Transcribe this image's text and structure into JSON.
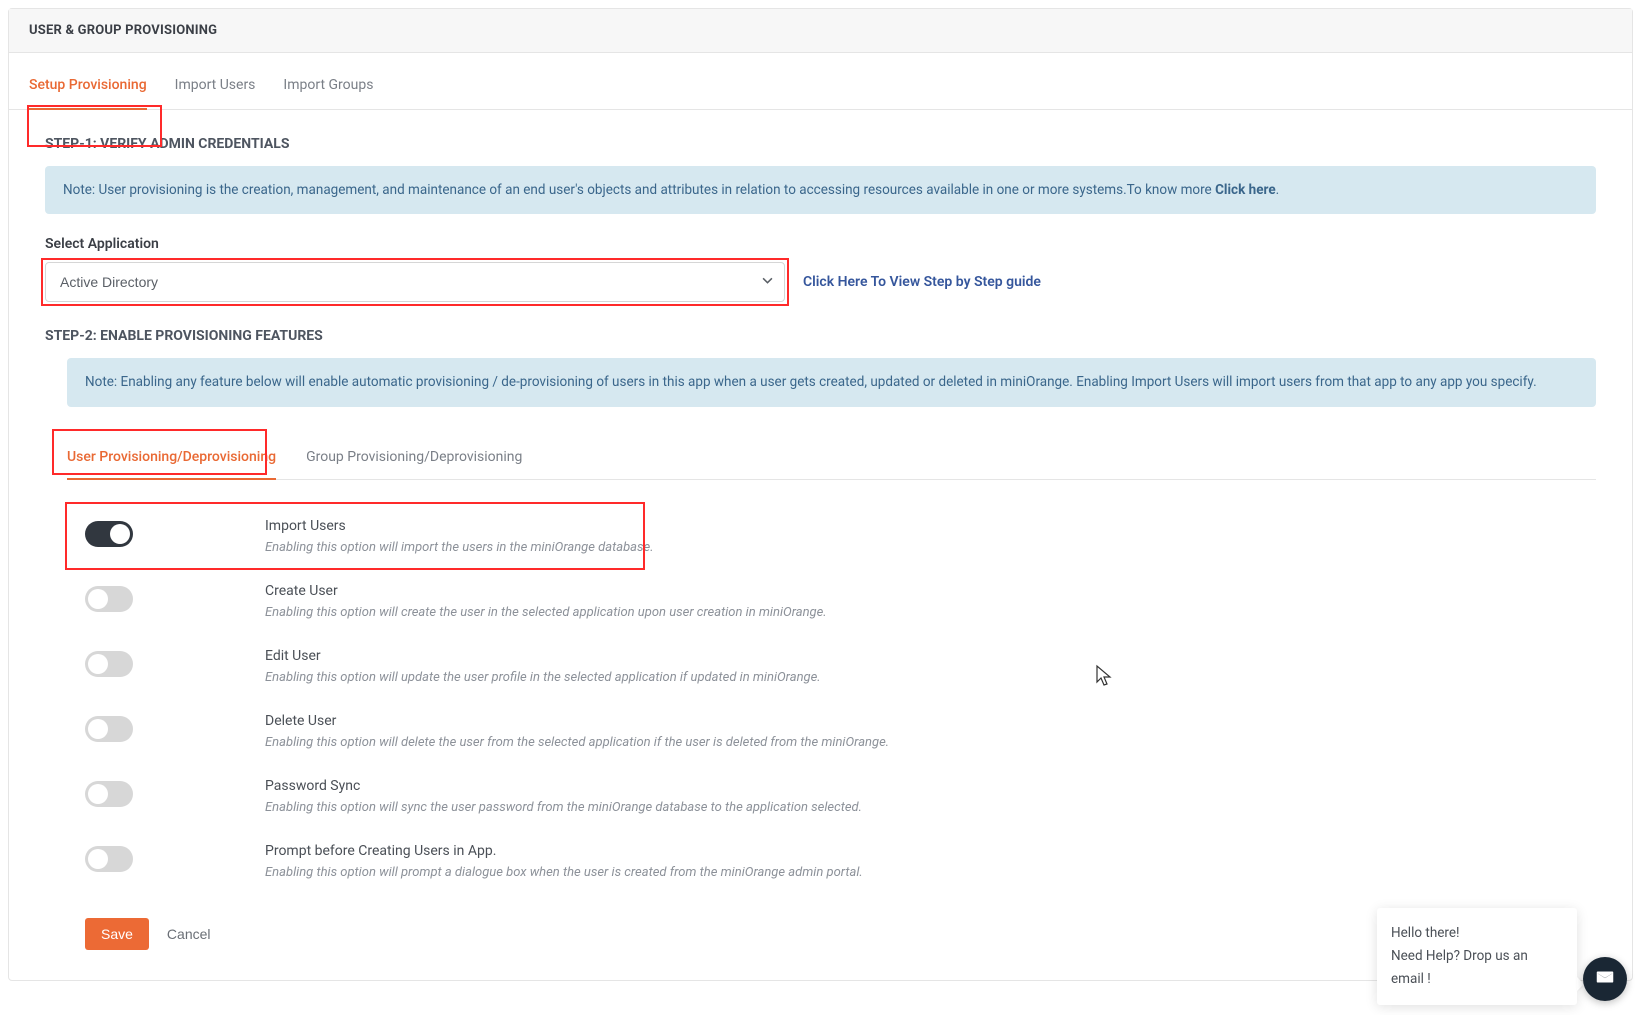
{
  "header": {
    "title": "USER & GROUP PROVISIONING"
  },
  "tabs": {
    "setup": "Setup Provisioning",
    "import_users": "Import Users",
    "import_groups": "Import Groups"
  },
  "step1": {
    "title": "STEP-1: VERIFY ADMIN CREDENTIALS",
    "note_prefix": "Note: User provisioning is the creation, management, and maintenance of an end user's objects and attributes in relation to accessing resources available in one or more systems.To know more ",
    "note_link": "Click here",
    "note_suffix": ".",
    "select_label": "Select Application",
    "select_value": "Active Directory",
    "guide_link": "Click Here To View Step by Step guide"
  },
  "step2": {
    "title": "STEP-2: ENABLE PROVISIONING FEATURES",
    "note": "Note: Enabling any feature below will enable automatic provisioning / de-provisioning of users in this app when a user gets created, updated or deleted in miniOrange. Enabling Import Users will import users from that app to any app you specify."
  },
  "subtabs": {
    "user": "User Provisioning/Deprovisioning",
    "group": "Group Provisioning/Deprovisioning"
  },
  "features": [
    {
      "title": "Import Users",
      "desc": "Enabling this option will import the users in the miniOrange database.",
      "on": true
    },
    {
      "title": "Create User",
      "desc": "Enabling this option will create the user in the selected application upon user creation in miniOrange.",
      "on": false
    },
    {
      "title": "Edit User",
      "desc": "Enabling this option will update the user profile in the selected application if updated in miniOrange.",
      "on": false
    },
    {
      "title": "Delete User",
      "desc": "Enabling this option will delete the user from the selected application if the user is deleted from the miniOrange.",
      "on": false
    },
    {
      "title": "Password Sync",
      "desc": "Enabling this option will sync the user password from the miniOrange database to the application selected.",
      "on": false
    },
    {
      "title": "Prompt before Creating Users in App.",
      "desc": "Enabling this option will prompt a dialogue box when the user is created from the miniOrange admin portal.",
      "on": false
    }
  ],
  "actions": {
    "save": "Save",
    "cancel": "Cancel"
  },
  "help": {
    "line1": "Hello there!",
    "line2": "Need Help? Drop us an email !"
  }
}
